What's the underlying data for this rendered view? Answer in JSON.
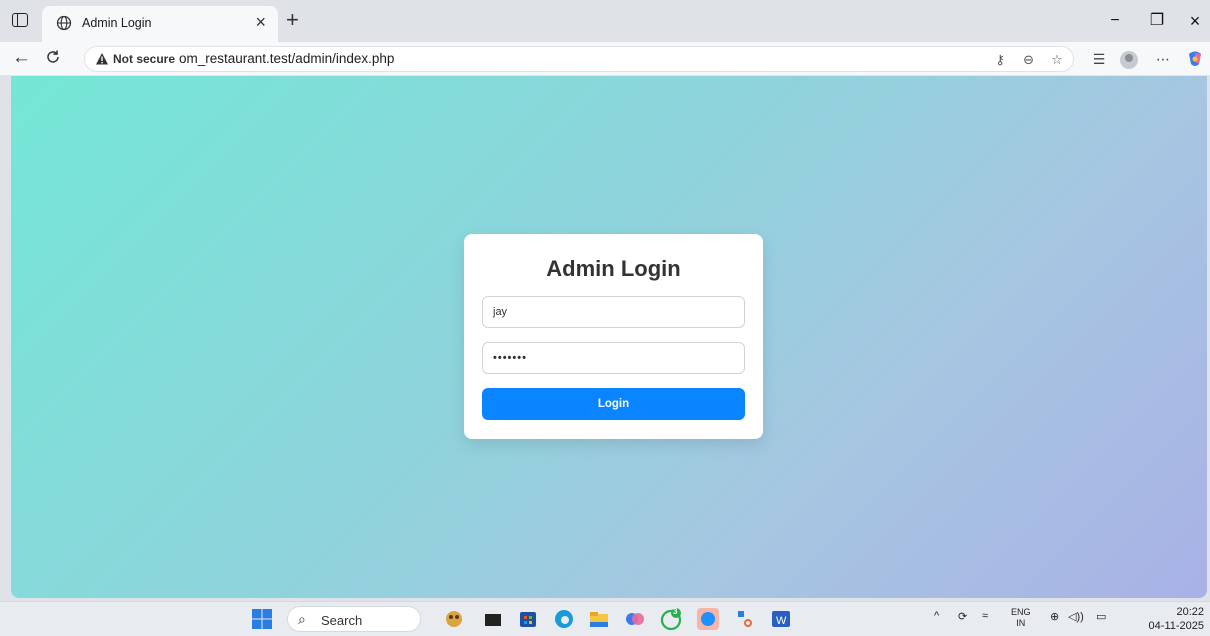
{
  "browser": {
    "tab_title": "Admin Login",
    "tab_close": "×",
    "new_tab": "+",
    "security_label": "Not secure",
    "url": "om_restaurant.test/admin/index.php",
    "window_minimize": "−",
    "window_restore": "❐",
    "window_close": "×",
    "icons": [
      "tab-actions-icon",
      "globe-icon",
      "back-icon",
      "reload-icon",
      "warning-icon",
      "key-icon",
      "zoom-icon",
      "favorite-icon",
      "favorites-bar-icon",
      "profile-avatar",
      "more-icon",
      "copilot-icon"
    ]
  },
  "login": {
    "title": "Admin Login",
    "username_value": "jay",
    "password_value": "•••••••",
    "button_label": "Login"
  },
  "taskbar": {
    "search_label": "Search",
    "language": "ENG",
    "region": "IN",
    "time": "20:22",
    "date": "04-11-2025",
    "whatsapp_badge": "3",
    "icons": [
      "windows-start-icon",
      "search-icon",
      "weather-icon",
      "task-view-icon",
      "store-icon",
      "edge-icon",
      "file-explorer-icon",
      "copilot-icon",
      "whatsapp-icon",
      "app-icon",
      "snipping-tool-icon",
      "word-icon",
      "chevron-up-icon",
      "sync-icon",
      "network-off-icon",
      "globe-icon",
      "volume-icon",
      "battery-icon"
    ]
  },
  "colors": {
    "gradient_start": "#74e7d6",
    "gradient_end": "#a9b1e6",
    "button": "#0a84ff"
  }
}
